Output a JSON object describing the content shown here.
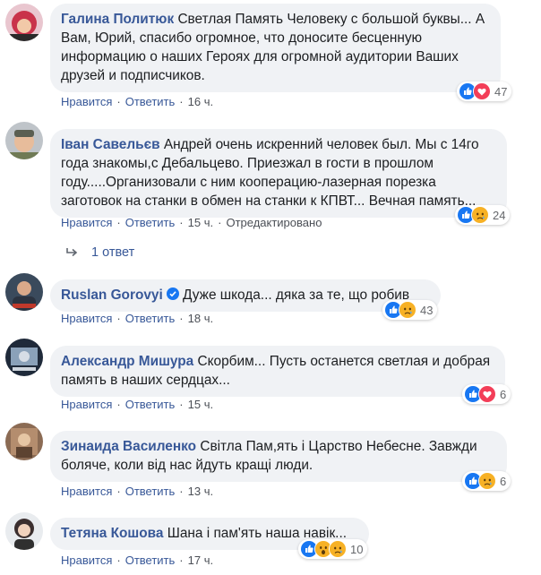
{
  "comments": [
    {
      "author": "Галина Политюк",
      "text": "Светлая Память Человеку с большой буквы... А Вам, Юрий, спасибо огромное, что доносите бесценную информацию о наших Героях для огромной аудитории Ваших друзей и подписчиков.",
      "like": "Нравится",
      "reply": "Ответить",
      "time": "16 ч.",
      "reactions": "47",
      "reaction_icons": [
        "like-icon",
        "heart-icon"
      ]
    },
    {
      "author": "Іван Савельєв",
      "text": "Андрей очень искренний человек был. Мы с 14го года знакомы,с Дебальцево. Приезжал в гости в прошлом году.....Организовали с ним кооперацию-лазерная порезка заготовок на станки в обмен на станки к КПВТ... Вечная память...",
      "like": "Нравится",
      "reply": "Ответить",
      "time": "15 ч.",
      "edited": "Отредактировано",
      "reactions": "24",
      "reaction_icons": [
        "like-icon",
        "sad-icon"
      ]
    },
    {
      "author": "Ruslan Gorovyi",
      "text": "Дуже шкода... дяка за те, що робив",
      "like": "Нравится",
      "reply": "Ответить",
      "time": "18 ч.",
      "reactions": "43",
      "reaction_icons": [
        "like-icon",
        "sad-icon"
      ]
    },
    {
      "author": "Александр Мишура",
      "text": "Скорбим... Пусть останется светлая и добрая память в наших сердцах...",
      "like": "Нравится",
      "reply": "Ответить",
      "time": "15 ч.",
      "reactions": "6",
      "reaction_icons": [
        "like-icon",
        "heart-icon"
      ]
    },
    {
      "author": "Зинаида Василенко",
      "text": "Світла Пам,ять і Царство Небесне. Завжди боляче, коли від нас йдуть кращі люди.",
      "like": "Нравится",
      "reply": "Ответить",
      "time": "13 ч.",
      "reactions": "6",
      "reaction_icons": [
        "like-icon",
        "sad-icon"
      ]
    },
    {
      "author": "Тетяна Кошова",
      "text": "Шана і пам'ять наша навік...",
      "like": "Нравится",
      "reply": "Ответить",
      "time": "17 ч.",
      "reactions": "10",
      "reaction_icons": [
        "like-icon",
        "wow-icon",
        "sad-icon"
      ]
    }
  ],
  "replies_link": "1 ответ",
  "colors": {
    "link": "#385898",
    "bubble": "#f0f2f5",
    "like": "#1877f2",
    "heart": "#f33e58",
    "sad": "#f7b125"
  }
}
